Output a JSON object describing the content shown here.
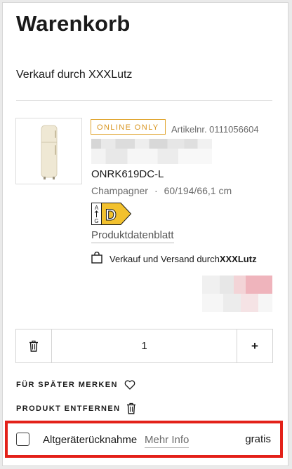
{
  "page_title": "Warenkorb",
  "seller_heading": "Verkauf durch XXXLutz",
  "product": {
    "badge": "ONLINE ONLY",
    "article_number": "Artikelnr. 0111056604",
    "model": "ONRK619DC-L",
    "color": "Champagner",
    "separator": "·",
    "dimensions": "60/194/66,1 cm",
    "energy_class": "D",
    "energy_scale_top": "A",
    "energy_scale_bottom": "G",
    "datasheet_link": "Produktdatenblatt",
    "shipping_text": "Verkauf und Versand durch ",
    "shipping_brand": "XXXLutz"
  },
  "quantity": {
    "value": "1",
    "plus_label": "+"
  },
  "actions": {
    "save_for_later": "FÜR SPÄTER MERKEN",
    "remove_product": "PRODUKT ENTFERNEN"
  },
  "recycling": {
    "label": "Altgeräterücknahme",
    "info_link": "Mehr Info",
    "price": "gratis",
    "checked": false
  },
  "colors": {
    "badge": "#d89520",
    "energy_label": "#f2c12e",
    "highlight_border": "#e32119"
  }
}
